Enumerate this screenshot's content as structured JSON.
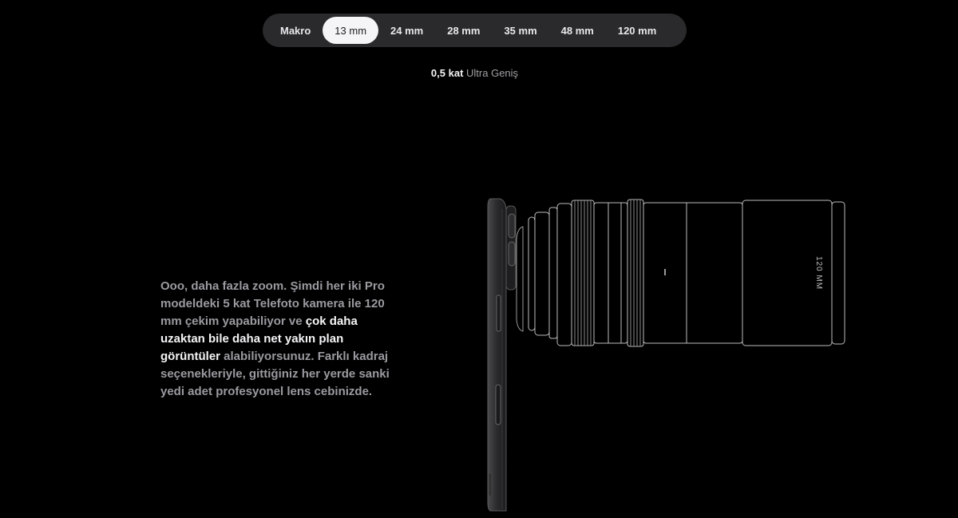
{
  "zoom_tabs": [
    {
      "label": "Makro",
      "active": false
    },
    {
      "label": "13 mm",
      "active": true
    },
    {
      "label": "24 mm",
      "active": false
    },
    {
      "label": "28 mm",
      "active": false
    },
    {
      "label": "35 mm",
      "active": false
    },
    {
      "label": "48 mm",
      "active": false
    },
    {
      "label": "120 mm",
      "active": false
    }
  ],
  "caption": {
    "factor": "0,5 kat",
    "lens_name": "Ultra Geniş"
  },
  "description": {
    "part1": "Ooo, daha fazla zoom. Şimdi her iki Pro modeldeki 5 kat Telefoto kamera ile 120 mm çekim yapabiliyor ve ",
    "highlight": "çok daha uzaktan bile daha net yakın plan görüntüler",
    "part2": " alabiliyorsunuz. Farklı kadraj seçenekleriyle, gittiğiniz her yerde sanki yedi adet profesyonel lens cebinizde."
  },
  "lens_label": "120 MM"
}
